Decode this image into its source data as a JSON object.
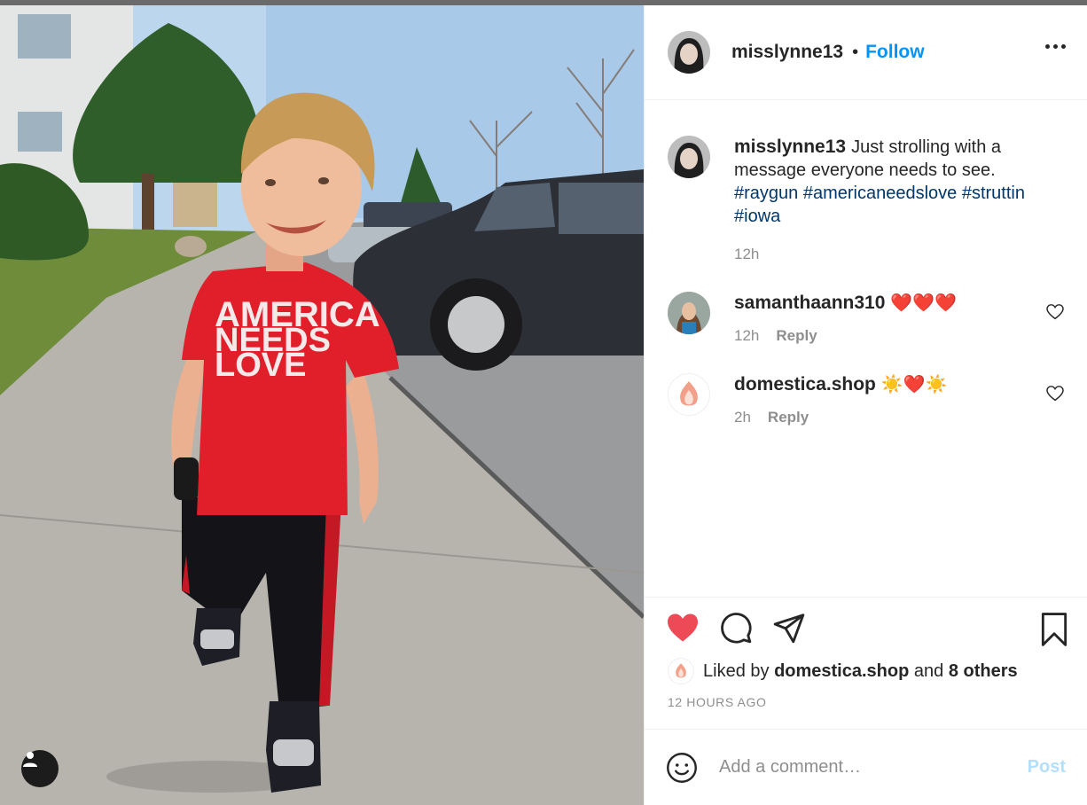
{
  "post": {
    "author": "misslynne13",
    "follow_label": "Follow",
    "separator": "•",
    "caption": {
      "text": "Just strolling with a message everyone needs to see.",
      "hashtags": [
        "#raygun",
        "#americaneedslove",
        "#struttin",
        "#iowa"
      ],
      "time": "12h"
    },
    "photo_shirt_lines": [
      "AMERICA",
      "NEEDS",
      "LOVE"
    ]
  },
  "comments": [
    {
      "user": "samanthaann310",
      "text": "❤️❤️❤️",
      "time": "12h",
      "reply_label": "Reply"
    },
    {
      "user": "domestica.shop",
      "text": "☀️❤️☀️",
      "time": "2h",
      "reply_label": "Reply"
    }
  ],
  "likes": {
    "prefix": "Liked by",
    "user": "domestica.shop",
    "and": "and",
    "others": "8 others"
  },
  "timestamp": "12 HOURS AGO",
  "comment_box": {
    "placeholder": "Add a comment…",
    "post_label": "Post"
  },
  "icons": [
    "user-tag-icon",
    "more-icon",
    "heart-icon",
    "comment-icon",
    "share-icon",
    "bookmark-icon",
    "emoji-icon"
  ],
  "colors": {
    "accent": "#0095f6",
    "liked": "#ed4956",
    "post_disabled": "#b2dffc",
    "hashtag": "#00376b"
  }
}
